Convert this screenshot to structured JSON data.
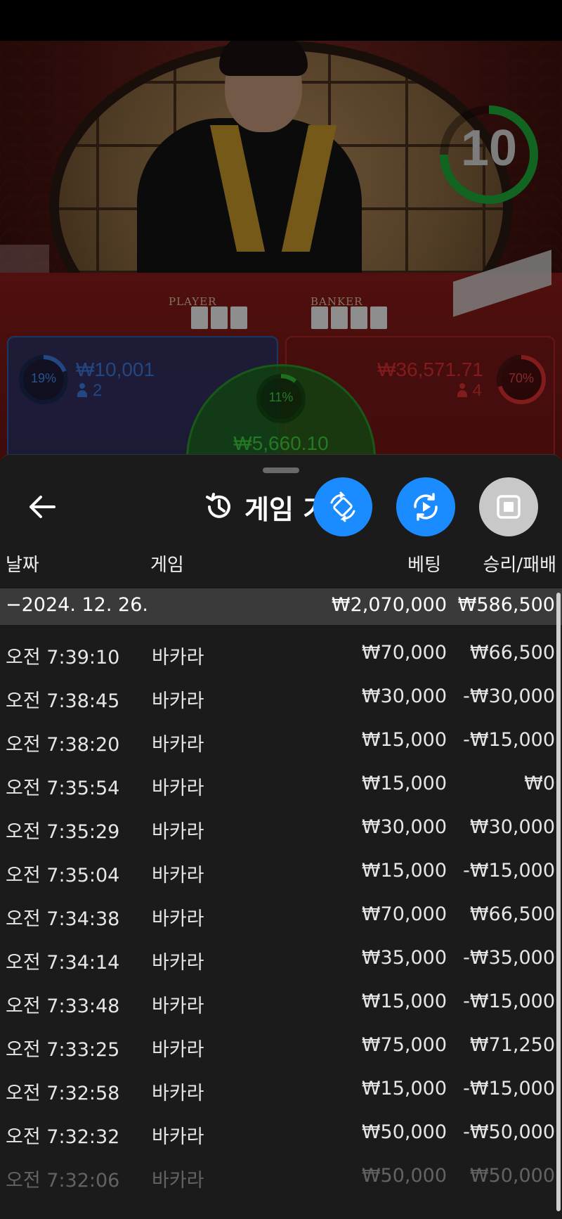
{
  "timer": {
    "value": "10",
    "progress": 0.75
  },
  "table_labels": {
    "player": "PLAYER",
    "banker": "BANKER"
  },
  "player": {
    "percent": "19%",
    "amount": "₩10,001",
    "players": "2"
  },
  "banker": {
    "percent": "70%",
    "amount": "₩36,571.71",
    "players": "4"
  },
  "tie": {
    "percent": "11%",
    "amount": "₩5,660.10"
  },
  "header": {
    "title": "게임 기록"
  },
  "columns": {
    "date": "날짜",
    "game": "게임",
    "bet": "베팅",
    "result": "승리/패배"
  },
  "summary": {
    "date": "−2024. 12. 26.",
    "bet": "₩2,070,000",
    "result": "₩586,500"
  },
  "rows": [
    {
      "time": "오전 7:39:10",
      "game": "바카라",
      "bet": "₩70,000",
      "result": "₩66,500"
    },
    {
      "time": "오전 7:38:45",
      "game": "바카라",
      "bet": "₩30,000",
      "result": "-₩30,000"
    },
    {
      "time": "오전 7:38:20",
      "game": "바카라",
      "bet": "₩15,000",
      "result": "-₩15,000"
    },
    {
      "time": "오전 7:35:54",
      "game": "바카라",
      "bet": "₩15,000",
      "result": "₩0"
    },
    {
      "time": "오전 7:35:29",
      "game": "바카라",
      "bet": "₩30,000",
      "result": "₩30,000"
    },
    {
      "time": "오전 7:35:04",
      "game": "바카라",
      "bet": "₩15,000",
      "result": "-₩15,000"
    },
    {
      "time": "오전 7:34:38",
      "game": "바카라",
      "bet": "₩70,000",
      "result": "₩66,500"
    },
    {
      "time": "오전 7:34:14",
      "game": "바카라",
      "bet": "₩35,000",
      "result": "-₩35,000"
    },
    {
      "time": "오전 7:33:48",
      "game": "바카라",
      "bet": "₩15,000",
      "result": "-₩15,000"
    },
    {
      "time": "오전 7:33:25",
      "game": "바카라",
      "bet": "₩75,000",
      "result": "₩71,250"
    },
    {
      "time": "오전 7:32:58",
      "game": "바카라",
      "bet": "₩15,000",
      "result": "-₩15,000"
    },
    {
      "time": "오전 7:32:32",
      "game": "바카라",
      "bet": "₩50,000",
      "result": "-₩50,000"
    },
    {
      "time": "오전 7:32:06",
      "game": "바카라",
      "bet": "₩50,000",
      "result": "₩50,000"
    }
  ],
  "colors": {
    "accent_blue": "#1a8cff",
    "player_blue": "#2d5fb0",
    "banker_red": "#b02626",
    "tie_green": "#2a9a2a",
    "timer_green": "#1fae3a"
  },
  "icons": {
    "back": "arrow-left-icon",
    "history": "history-icon",
    "rotate": "rotate-phone-icon",
    "replay": "replay-icon",
    "stop": "stop-icon"
  }
}
